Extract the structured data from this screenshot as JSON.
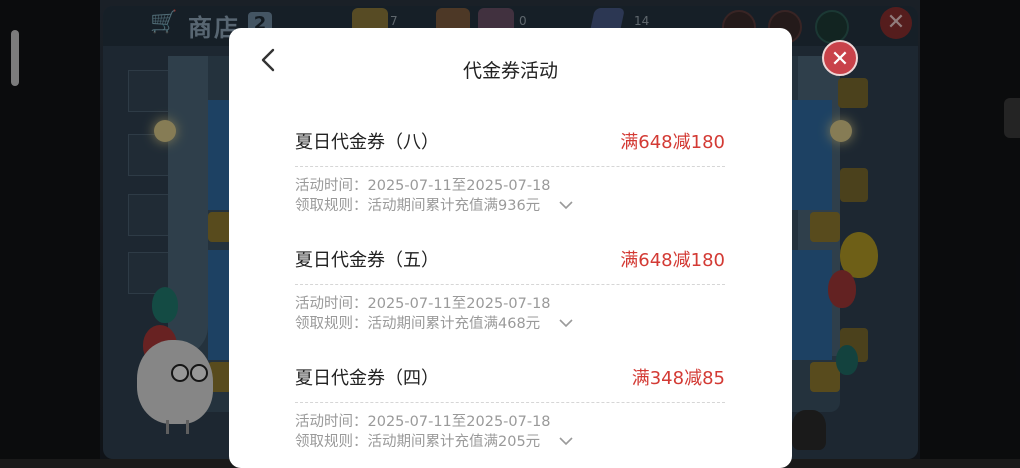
{
  "background": {
    "shop_title": "商店",
    "shop_title_badge": "2",
    "currency_1_value": "7",
    "currency_3_value": "0",
    "currency_4_value": "14",
    "game_close_glyph": "✕",
    "icons": [
      "cart-icon",
      "currency-icon",
      "gem-icon",
      "close-icon"
    ]
  },
  "dialog": {
    "title": "代金券活动",
    "back_icon": "chevron-left-icon",
    "close_glyph": "✕",
    "coupons": [
      {
        "name": "夏日代金券（八）",
        "offer": "满648减180",
        "time": "活动时间：2025-07-11至2025-07-18",
        "rule": "领取规则：活动期间累计充值满936元"
      },
      {
        "name": "夏日代金券（五）",
        "offer": "满648减180",
        "time": "活动时间：2025-07-11至2025-07-18",
        "rule": "领取规则：活动期间累计充值满468元"
      },
      {
        "name": "夏日代金券（四）",
        "offer": "满348减85",
        "time": "活动时间：2025-07-11至2025-07-18",
        "rule": "领取规则：活动期间累计充值满205元"
      }
    ]
  },
  "colors": {
    "offer_red": "#d33a34",
    "text_dark": "#222222",
    "text_muted": "#9a9a9a",
    "close_red": "#c9424a"
  }
}
